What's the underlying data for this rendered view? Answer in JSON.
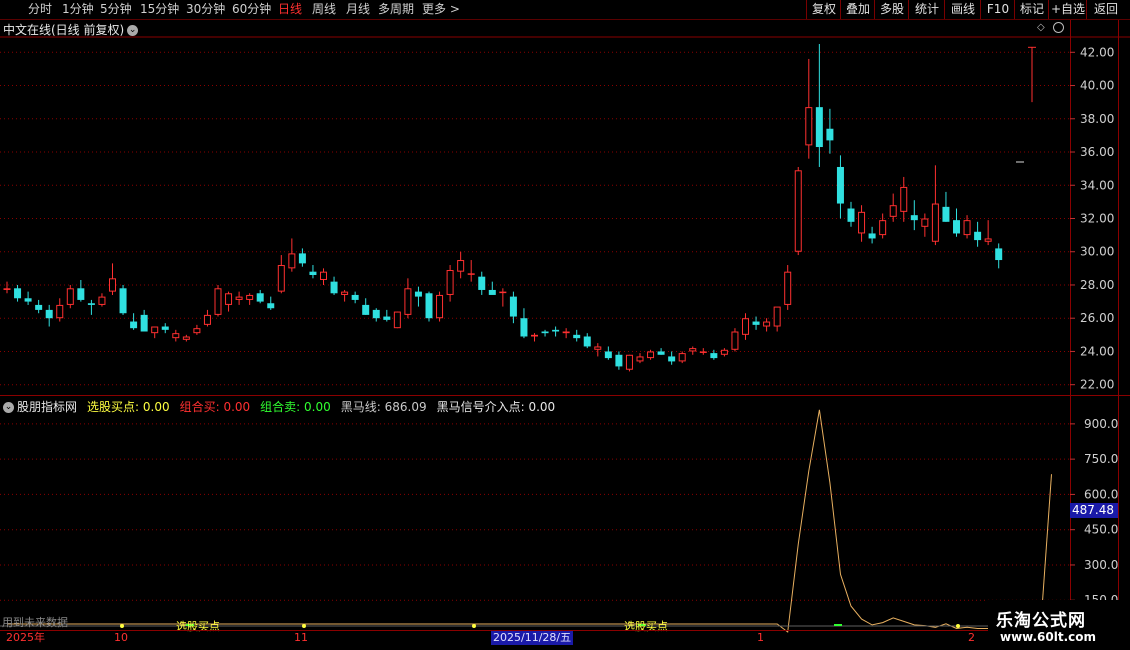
{
  "toolbar": {
    "periods": [
      "分时",
      "1分钟",
      "5分钟",
      "15分钟",
      "30分钟",
      "60分钟",
      "日线",
      "周线",
      "月线",
      "多周期",
      "更多"
    ],
    "active": "日线",
    "more_arrow": ">",
    "right_buttons": [
      "复权",
      "叠加",
      "多股",
      "统计",
      "画线",
      "F10",
      "标记",
      "+自选",
      "返回"
    ]
  },
  "main_chart": {
    "title": "中文在线(日线 前复权)",
    "y_ticks": [
      "42.00",
      "40.00",
      "38.00",
      "36.00",
      "34.00",
      "32.00",
      "30.00",
      "28.00",
      "26.00",
      "24.00",
      "22.00"
    ]
  },
  "indicator": {
    "name": "股朋指标网",
    "items": [
      {
        "label": "选股买点:",
        "value": "0.00",
        "color": "#ffff40"
      },
      {
        "label": "组合买:",
        "value": "0.00",
        "color": "#ff3030"
      },
      {
        "label": "组合卖:",
        "value": "0.00",
        "color": "#30ff30"
      },
      {
        "label": "黑马线:",
        "value": "686.09",
        "color": "#c8c8c8"
      },
      {
        "label": "黑马信号介入点:",
        "value": "0.00",
        "color": "#e8e8e8"
      }
    ],
    "y_ticks": [
      "900.0",
      "750.0",
      "600.0",
      "450.0",
      "300.0",
      "150.0"
    ],
    "current_value": "487.48",
    "signal_labels": [
      "选股买点",
      "选股买点"
    ],
    "future_note": "用到未来数据"
  },
  "date_axis": {
    "labels": [
      "2025年",
      "10",
      "11",
      "1",
      "2"
    ],
    "selected": "2025/11/28/五"
  },
  "watermark": {
    "title": "乐淘公式网",
    "url": "www.60lt.com"
  },
  "colors": {
    "up": "#ff3030",
    "down": "#30e0e0",
    "grid": "#8a0000",
    "hm_line": "#e8b060",
    "signal": "#ffff40"
  },
  "chart_data": {
    "type": "candlestick",
    "candles": [
      [
        27.7,
        28.2,
        27.5,
        27.8
      ],
      [
        27.8,
        28.0,
        27.0,
        27.2
      ],
      [
        27.2,
        27.6,
        26.8,
        27.0
      ],
      [
        26.8,
        27.1,
        26.3,
        26.5
      ],
      [
        26.5,
        26.8,
        25.5,
        26.0
      ],
      [
        26.0,
        27.2,
        25.8,
        26.8
      ],
      [
        26.8,
        28.0,
        26.6,
        27.8
      ],
      [
        27.8,
        28.3,
        27.0,
        27.1
      ],
      [
        26.9,
        27.1,
        26.2,
        26.8
      ],
      [
        26.8,
        27.5,
        26.7,
        27.3
      ],
      [
        27.6,
        29.3,
        27.4,
        28.4
      ],
      [
        27.8,
        28.0,
        26.2,
        26.3
      ],
      [
        25.8,
        26.3,
        25.3,
        25.4
      ],
      [
        26.2,
        26.5,
        25.2,
        25.2
      ],
      [
        25.1,
        25.5,
        24.8,
        25.5
      ],
      [
        25.5,
        25.7,
        25.1,
        25.3
      ],
      [
        24.8,
        25.3,
        24.6,
        25.1
      ],
      [
        24.7,
        25.0,
        24.6,
        24.9
      ],
      [
        25.1,
        25.6,
        25.0,
        25.4
      ],
      [
        25.6,
        26.5,
        25.5,
        26.2
      ],
      [
        26.2,
        28.0,
        26.1,
        27.8
      ],
      [
        26.8,
        27.6,
        26.4,
        27.5
      ],
      [
        27.1,
        27.6,
        26.8,
        27.3
      ],
      [
        27.1,
        27.5,
        26.8,
        27.4
      ],
      [
        27.5,
        27.7,
        26.9,
        27.0
      ],
      [
        26.9,
        27.3,
        26.5,
        26.6
      ],
      [
        27.6,
        29.8,
        27.5,
        29.2
      ],
      [
        29.0,
        30.8,
        28.8,
        29.9
      ],
      [
        29.9,
        30.2,
        29.1,
        29.3
      ],
      [
        28.8,
        29.2,
        28.4,
        28.6
      ],
      [
        28.3,
        29.0,
        28.0,
        28.8
      ],
      [
        28.2,
        28.5,
        27.4,
        27.5
      ],
      [
        27.4,
        27.7,
        27.0,
        27.6
      ],
      [
        27.4,
        27.6,
        26.9,
        27.1
      ],
      [
        26.8,
        27.2,
        26.2,
        26.2
      ],
      [
        26.5,
        26.6,
        25.8,
        26.0
      ],
      [
        26.1,
        26.5,
        25.8,
        25.9
      ],
      [
        25.4,
        26.4,
        25.4,
        26.4
      ],
      [
        26.2,
        28.4,
        26.0,
        27.8
      ],
      [
        27.6,
        27.9,
        26.7,
        27.3
      ],
      [
        27.5,
        27.6,
        25.8,
        26.0
      ],
      [
        26.0,
        27.6,
        25.8,
        27.4
      ],
      [
        27.4,
        29.2,
        27.0,
        28.9
      ],
      [
        28.8,
        30.0,
        28.4,
        29.5
      ],
      [
        28.7,
        29.5,
        28.2,
        28.7
      ],
      [
        28.5,
        28.8,
        27.4,
        27.7
      ],
      [
        27.7,
        28.2,
        27.5,
        27.4
      ],
      [
        27.6,
        27.8,
        26.7,
        27.6
      ],
      [
        27.3,
        27.6,
        25.7,
        26.1
      ],
      [
        26.0,
        26.6,
        24.8,
        24.9
      ],
      [
        24.9,
        25.1,
        24.6,
        25.0
      ],
      [
        25.2,
        25.3,
        24.9,
        25.1
      ],
      [
        25.3,
        25.5,
        24.9,
        25.2
      ],
      [
        25.1,
        25.4,
        24.8,
        25.2
      ],
      [
        25.0,
        25.3,
        24.6,
        24.8
      ],
      [
        24.9,
        25.1,
        24.2,
        24.3
      ],
      [
        24.1,
        24.5,
        23.7,
        24.3
      ],
      [
        24.0,
        24.3,
        23.5,
        23.6
      ],
      [
        23.8,
        24.0,
        22.9,
        23.1
      ],
      [
        22.9,
        23.8,
        22.8,
        23.8
      ],
      [
        23.4,
        23.9,
        23.3,
        23.7
      ],
      [
        23.6,
        24.1,
        23.5,
        24.0
      ],
      [
        24.0,
        24.2,
        23.8,
        23.8
      ],
      [
        23.7,
        24.0,
        23.2,
        23.4
      ],
      [
        23.4,
        24.0,
        23.3,
        23.9
      ],
      [
        24.0,
        24.3,
        23.8,
        24.2
      ],
      [
        24.0,
        24.2,
        23.8,
        24.0
      ],
      [
        23.9,
        24.1,
        23.5,
        23.6
      ],
      [
        23.8,
        24.2,
        23.7,
        24.1
      ],
      [
        24.1,
        25.4,
        24.0,
        25.2
      ],
      [
        25.0,
        26.3,
        24.7,
        26.0
      ],
      [
        25.8,
        26.1,
        25.3,
        25.6
      ],
      [
        25.5,
        26.0,
        25.2,
        25.8
      ],
      [
        25.5,
        26.3,
        25.2,
        26.7
      ],
      [
        26.8,
        29.2,
        26.5,
        28.8
      ],
      [
        30.0,
        35.1,
        29.8,
        34.9
      ],
      [
        36.4,
        41.6,
        35.6,
        38.7
      ],
      [
        38.7,
        42.5,
        35.1,
        36.3
      ],
      [
        37.4,
        38.6,
        35.9,
        36.7
      ],
      [
        35.1,
        35.8,
        32.0,
        32.9
      ],
      [
        32.6,
        33.0,
        31.5,
        31.8
      ],
      [
        31.1,
        32.8,
        30.6,
        32.4
      ],
      [
        31.1,
        31.5,
        30.5,
        30.8
      ],
      [
        31.0,
        32.3,
        30.8,
        31.9
      ],
      [
        32.1,
        33.5,
        31.8,
        32.8
      ],
      [
        32.4,
        34.5,
        31.8,
        33.9
      ],
      [
        32.2,
        33.1,
        31.3,
        31.9
      ],
      [
        31.5,
        32.3,
        30.9,
        32.0
      ],
      [
        30.6,
        35.2,
        30.4,
        32.9
      ],
      [
        32.7,
        33.6,
        31.8,
        31.8
      ],
      [
        31.9,
        32.6,
        30.9,
        31.1
      ],
      [
        31.0,
        32.2,
        30.8,
        31.9
      ],
      [
        31.2,
        31.8,
        30.3,
        30.7
      ],
      [
        30.6,
        31.9,
        30.4,
        30.8
      ],
      [
        30.2,
        30.5,
        29.0,
        29.5
      ]
    ],
    "today": {
      "open": 39.0,
      "high": 42.3,
      "low": 39.0,
      "close": 42.3,
      "mark": 35.4
    },
    "y_range": [
      21.5,
      42.8
    ],
    "hm_line_values": [
      0,
      0,
      0,
      0,
      0,
      0,
      0,
      0,
      0,
      0,
      0,
      0,
      0,
      0,
      0,
      0,
      0,
      0,
      0,
      0,
      0,
      0,
      0,
      0,
      0,
      0,
      0,
      0,
      0,
      0,
      0,
      0,
      0,
      0,
      0,
      0,
      0,
      0,
      0,
      0,
      0,
      0,
      0,
      0,
      0,
      0,
      0,
      0,
      0,
      0,
      0,
      0,
      0,
      0,
      0,
      0,
      0,
      0,
      0,
      0,
      0,
      0,
      0,
      0,
      0,
      0,
      0,
      0,
      0,
      0,
      0,
      0,
      0,
      0,
      15,
      390,
      700,
      960,
      650,
      260,
      125,
      70,
      45,
      55,
      75,
      60,
      45,
      42,
      35,
      50,
      30,
      35,
      30,
      30,
      25,
      "x",
      0,
      686
    ],
    "hm_y_range": [
      100,
      1010
    ]
  }
}
